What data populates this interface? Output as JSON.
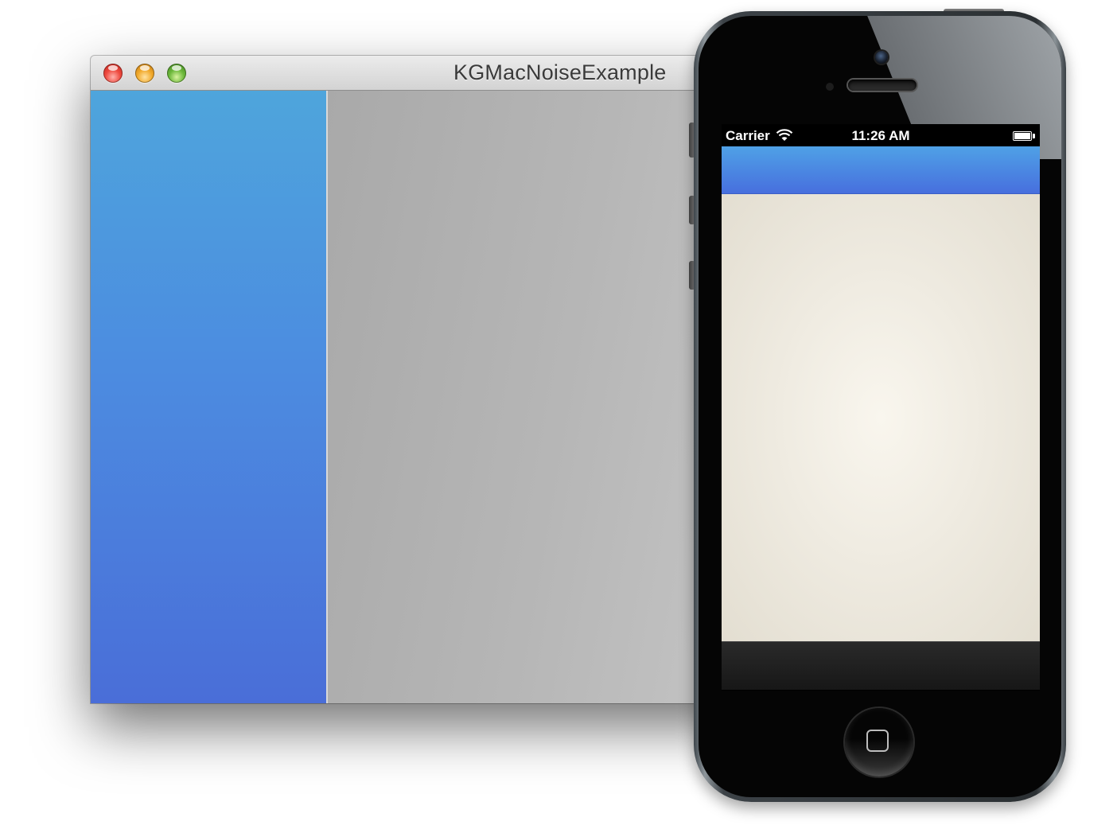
{
  "mac_window": {
    "title": "KGMacNoiseExample",
    "controls": [
      "close-icon",
      "minimize-icon",
      "zoom-icon"
    ],
    "sidebar_colors": {
      "top": "#4ea5dc",
      "bottom": "#4a6ed8"
    },
    "content_color": "#b6b6b6"
  },
  "iphone": {
    "status_bar": {
      "carrier": "Carrier",
      "time": "11:26 AM",
      "icons": [
        "wifi-icon",
        "battery-icon"
      ]
    },
    "navbar_colors": {
      "top": "#4fa1e6",
      "bottom": "#476fde"
    },
    "content_color": "#efebe1",
    "toolbar_color": "#1f1f1f",
    "home_button_icon": "home-square-icon"
  }
}
